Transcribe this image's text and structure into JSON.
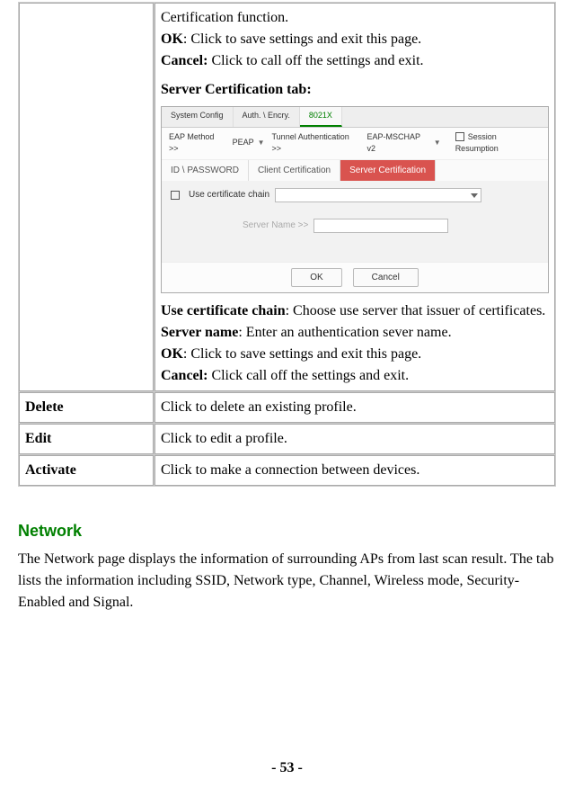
{
  "table": {
    "row0": {
      "cert_func": "Certification function.",
      "ok_b": "OK",
      "ok_t": ": Click to save settings and exit this page.",
      "cancel_b": "Cancel:",
      "cancel_t": " Click to call off the settings and exit.",
      "tab_heading": "Server Certification tab:",
      "ucc_b": "Use certificate chain",
      "ucc_t": ": Choose use server that issuer of certificates.",
      "sn_b": "Server name",
      "sn_t": ": Enter an authentication sever name.",
      "ok2_b": "OK",
      "ok2_t": ": Click to save settings and exit this page.",
      "cancel2_b": "Cancel:",
      "cancel2_t": " Click call off the settings and exit."
    },
    "rows": [
      {
        "left": "Delete",
        "right": "Click to delete an existing profile."
      },
      {
        "left": "Edit",
        "right": "Click to edit a profile."
      },
      {
        "left": "Activate",
        "right": "Click to make a connection between devices."
      }
    ]
  },
  "screenshot": {
    "tabs": {
      "t1": "System Config",
      "t2": "Auth. \\ Encry.",
      "t3": "8021X"
    },
    "row2": {
      "eap_label": "EAP Method >>",
      "eap_val": "PEAP",
      "tun_label": "Tunnel Authentication >>",
      "tun_val": "EAP-MSCHAP v2",
      "session": "Session Resumption"
    },
    "subtabs": {
      "s1": "ID \\ PASSWORD",
      "s2": "Client Certification",
      "s3": "Server Certification"
    },
    "use_chain": "Use certificate chain",
    "server_name_lbl": "Server Name >>",
    "btn_ok": "OK",
    "btn_cancel": "Cancel"
  },
  "section": {
    "heading": "Network",
    "text": "The Network page displays the information of surrounding APs from last scan result. The tab lists the information including SSID, Network type, Channel, Wireless mode, Security-Enabled and Signal."
  },
  "pagenum": "- 53 -"
}
